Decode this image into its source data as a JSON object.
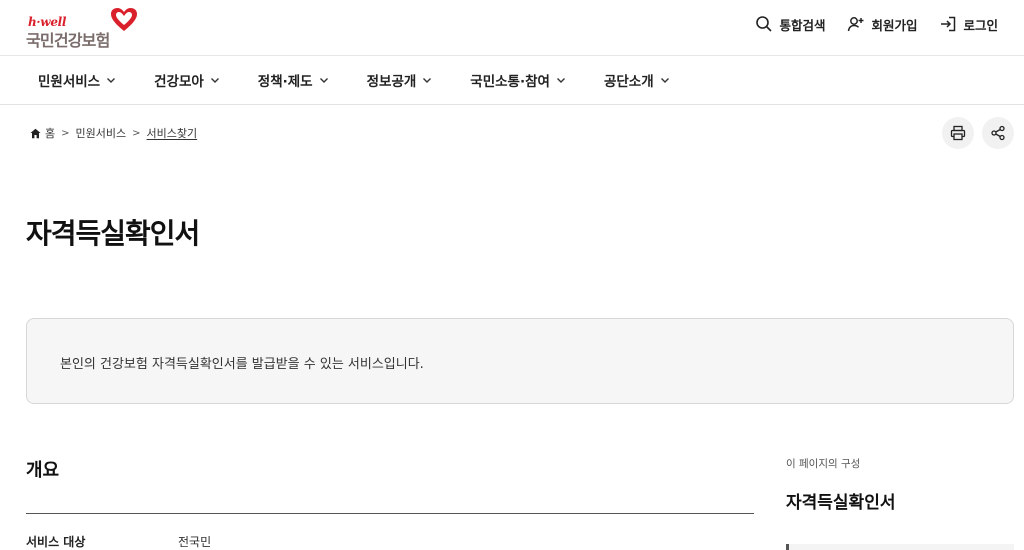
{
  "header": {
    "logo_small": "h·well",
    "logo_main": "국민건강보험",
    "util": [
      {
        "label": "통합검색",
        "icon": "search-icon"
      },
      {
        "label": "회원가입",
        "icon": "user-plus-icon"
      },
      {
        "label": "로그인",
        "icon": "login-icon"
      }
    ]
  },
  "gnb": [
    {
      "label": "민원서비스"
    },
    {
      "label": "건강모아"
    },
    {
      "label": "정책·제도"
    },
    {
      "label": "정보공개"
    },
    {
      "label": "국민소통·참여"
    },
    {
      "label": "공단소개"
    }
  ],
  "breadcrumb": {
    "home": "홈",
    "level1": "민원서비스",
    "current": "서비스찾기"
  },
  "page": {
    "title": "자격득실확인서",
    "description": "본인의 건강보험 자격득실확인서를 발급받을 수 있는 서비스입니다."
  },
  "overview": {
    "title": "개요",
    "rows": [
      {
        "label": "서비스 대상",
        "value": "전국민"
      }
    ]
  },
  "aside": {
    "label": "이 페이지의 구성",
    "title": "자격득실확인서"
  },
  "colors": {
    "brand_red": "#d9202b",
    "logo_gray": "#7a6d6b",
    "box_bg": "#f6f6f6"
  }
}
